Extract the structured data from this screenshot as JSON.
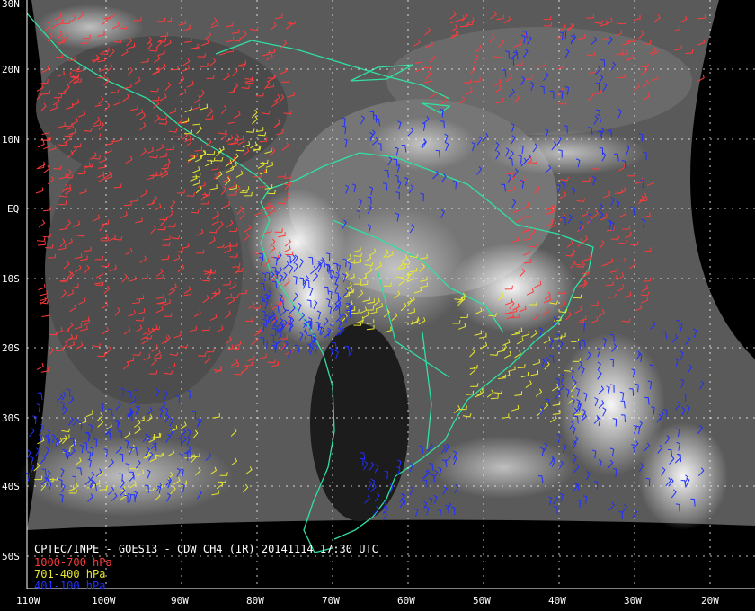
{
  "caption": "CPTEC/INPE - GOES13 - CDW CH4 (IR) 20141114 17:30 UTC",
  "legend": [
    {
      "label": "1000-700 hPa",
      "color": "#ff3a3a"
    },
    {
      "label": "701-400 hPa",
      "color": "#e8e830"
    },
    {
      "label": "401-100 hPa",
      "color": "#2030ff"
    }
  ],
  "lat_labels": [
    "30N",
    "20N",
    "10N",
    "EQ",
    "10S",
    "20S",
    "30S",
    "40S",
    "50S"
  ],
  "lon_labels": [
    "110W",
    "100W",
    "90W",
    "80W",
    "70W",
    "60W",
    "50W",
    "40W",
    "30W",
    "20W"
  ],
  "colors": {
    "coastline": "#30e0a0",
    "grid": "#ffffff",
    "background": "#000000"
  }
}
